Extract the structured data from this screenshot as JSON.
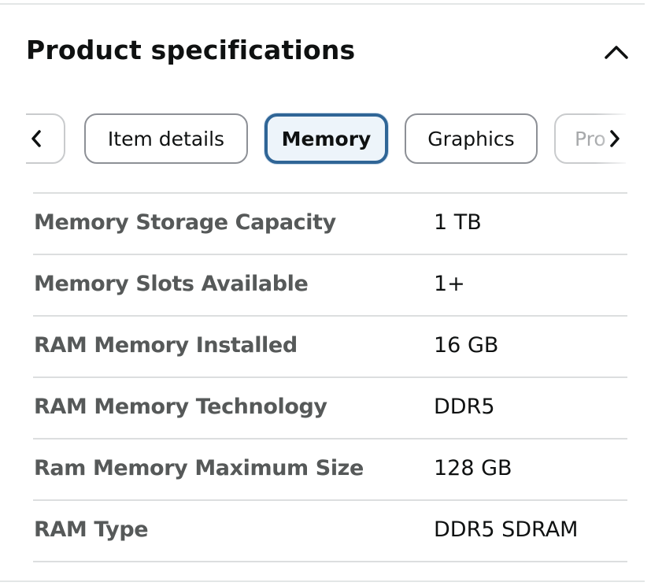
{
  "header": {
    "title": "Product specifications",
    "collapse_icon": "chevron-up-icon"
  },
  "tabs": {
    "prev_icon": "chevron-left-icon",
    "next_icon": "chevron-right-icon",
    "items": [
      {
        "label": "Item details",
        "selected": false
      },
      {
        "label": "Memory",
        "selected": true
      },
      {
        "label": "Graphics",
        "selected": false
      },
      {
        "label": "Pro",
        "selected": false
      }
    ],
    "selected_color": "#2f6596"
  },
  "specs": {
    "rows": [
      {
        "label": "Memory Storage Capacity",
        "value": "1 TB"
      },
      {
        "label": "Memory Slots Available",
        "value": "1+"
      },
      {
        "label": "RAM Memory Installed",
        "value": "16 GB"
      },
      {
        "label": "RAM Memory Technology",
        "value": "DDR5"
      },
      {
        "label": "Ram Memory Maximum Size",
        "value": "128 GB"
      },
      {
        "label": "RAM Type",
        "value": "DDR5 SDRAM"
      }
    ]
  }
}
